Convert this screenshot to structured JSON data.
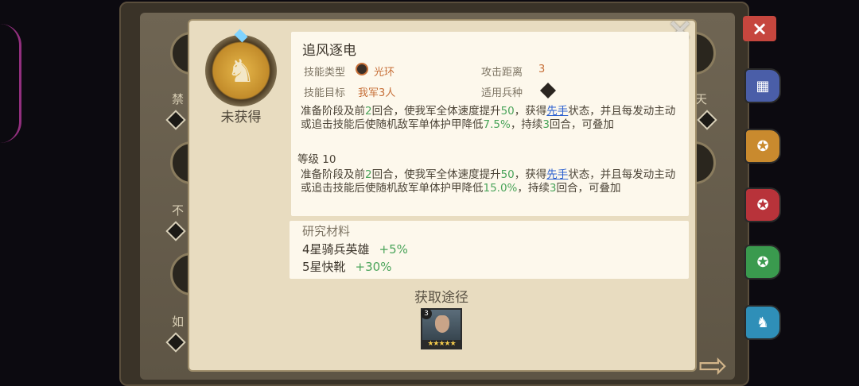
{
  "skill": {
    "name": "追风逐电",
    "status": "未获得",
    "type_label": "技能类型",
    "type_value": "光环",
    "target_label": "技能目标",
    "target_value": "我军3人",
    "range_label": "攻击距离",
    "range_value": "3",
    "unit_label": "适用兵种"
  },
  "desc_base": {
    "p1": "准备阶段及前",
    "n1": "2",
    "p2": "回合，使我军全体速度提升",
    "n2": "50",
    "p3": "，获得",
    "link": "先手",
    "p4": "状态，并且每发动主动或追击技能后使随机敌军单体护甲降低",
    "n3": "7.5%",
    "p5": "，持续",
    "n4": "3",
    "p6": "回合，可叠加"
  },
  "level_text": "等级 10",
  "desc_max": {
    "p1": "准备阶段及前",
    "n1": "2",
    "p2": "回合，使我军全体速度提升",
    "n2": "50",
    "p3": "，获得",
    "link": "先手",
    "p4": "状态，并且每发动主动或追击技能后使随机敌军单体护甲降低",
    "n3": "15.0%",
    "p5": "，持续",
    "n4": "3",
    "p6": "回合，可叠加"
  },
  "materials": {
    "title": "研究材料",
    "items": [
      {
        "name": "4星骑兵英雄",
        "bonus": "+5%"
      },
      {
        "name": "5星快靴",
        "bonus": "+30%"
      }
    ]
  },
  "acquire": {
    "title": "获取途径",
    "hero_badge": "3",
    "hero_stars": "★★★★★"
  },
  "background": {
    "left_labels": [
      "禁",
      "不",
      "如"
    ],
    "right_labels": [
      "天"
    ]
  },
  "colors": {
    "highlight": "#4aa45a",
    "value_orange": "#c66f38",
    "link": "#2a5fcf",
    "panel": "#fdf8ec",
    "card": "#e8dcc0"
  },
  "icons": {
    "close": "×",
    "next": "⇨",
    "horse": "♞"
  }
}
